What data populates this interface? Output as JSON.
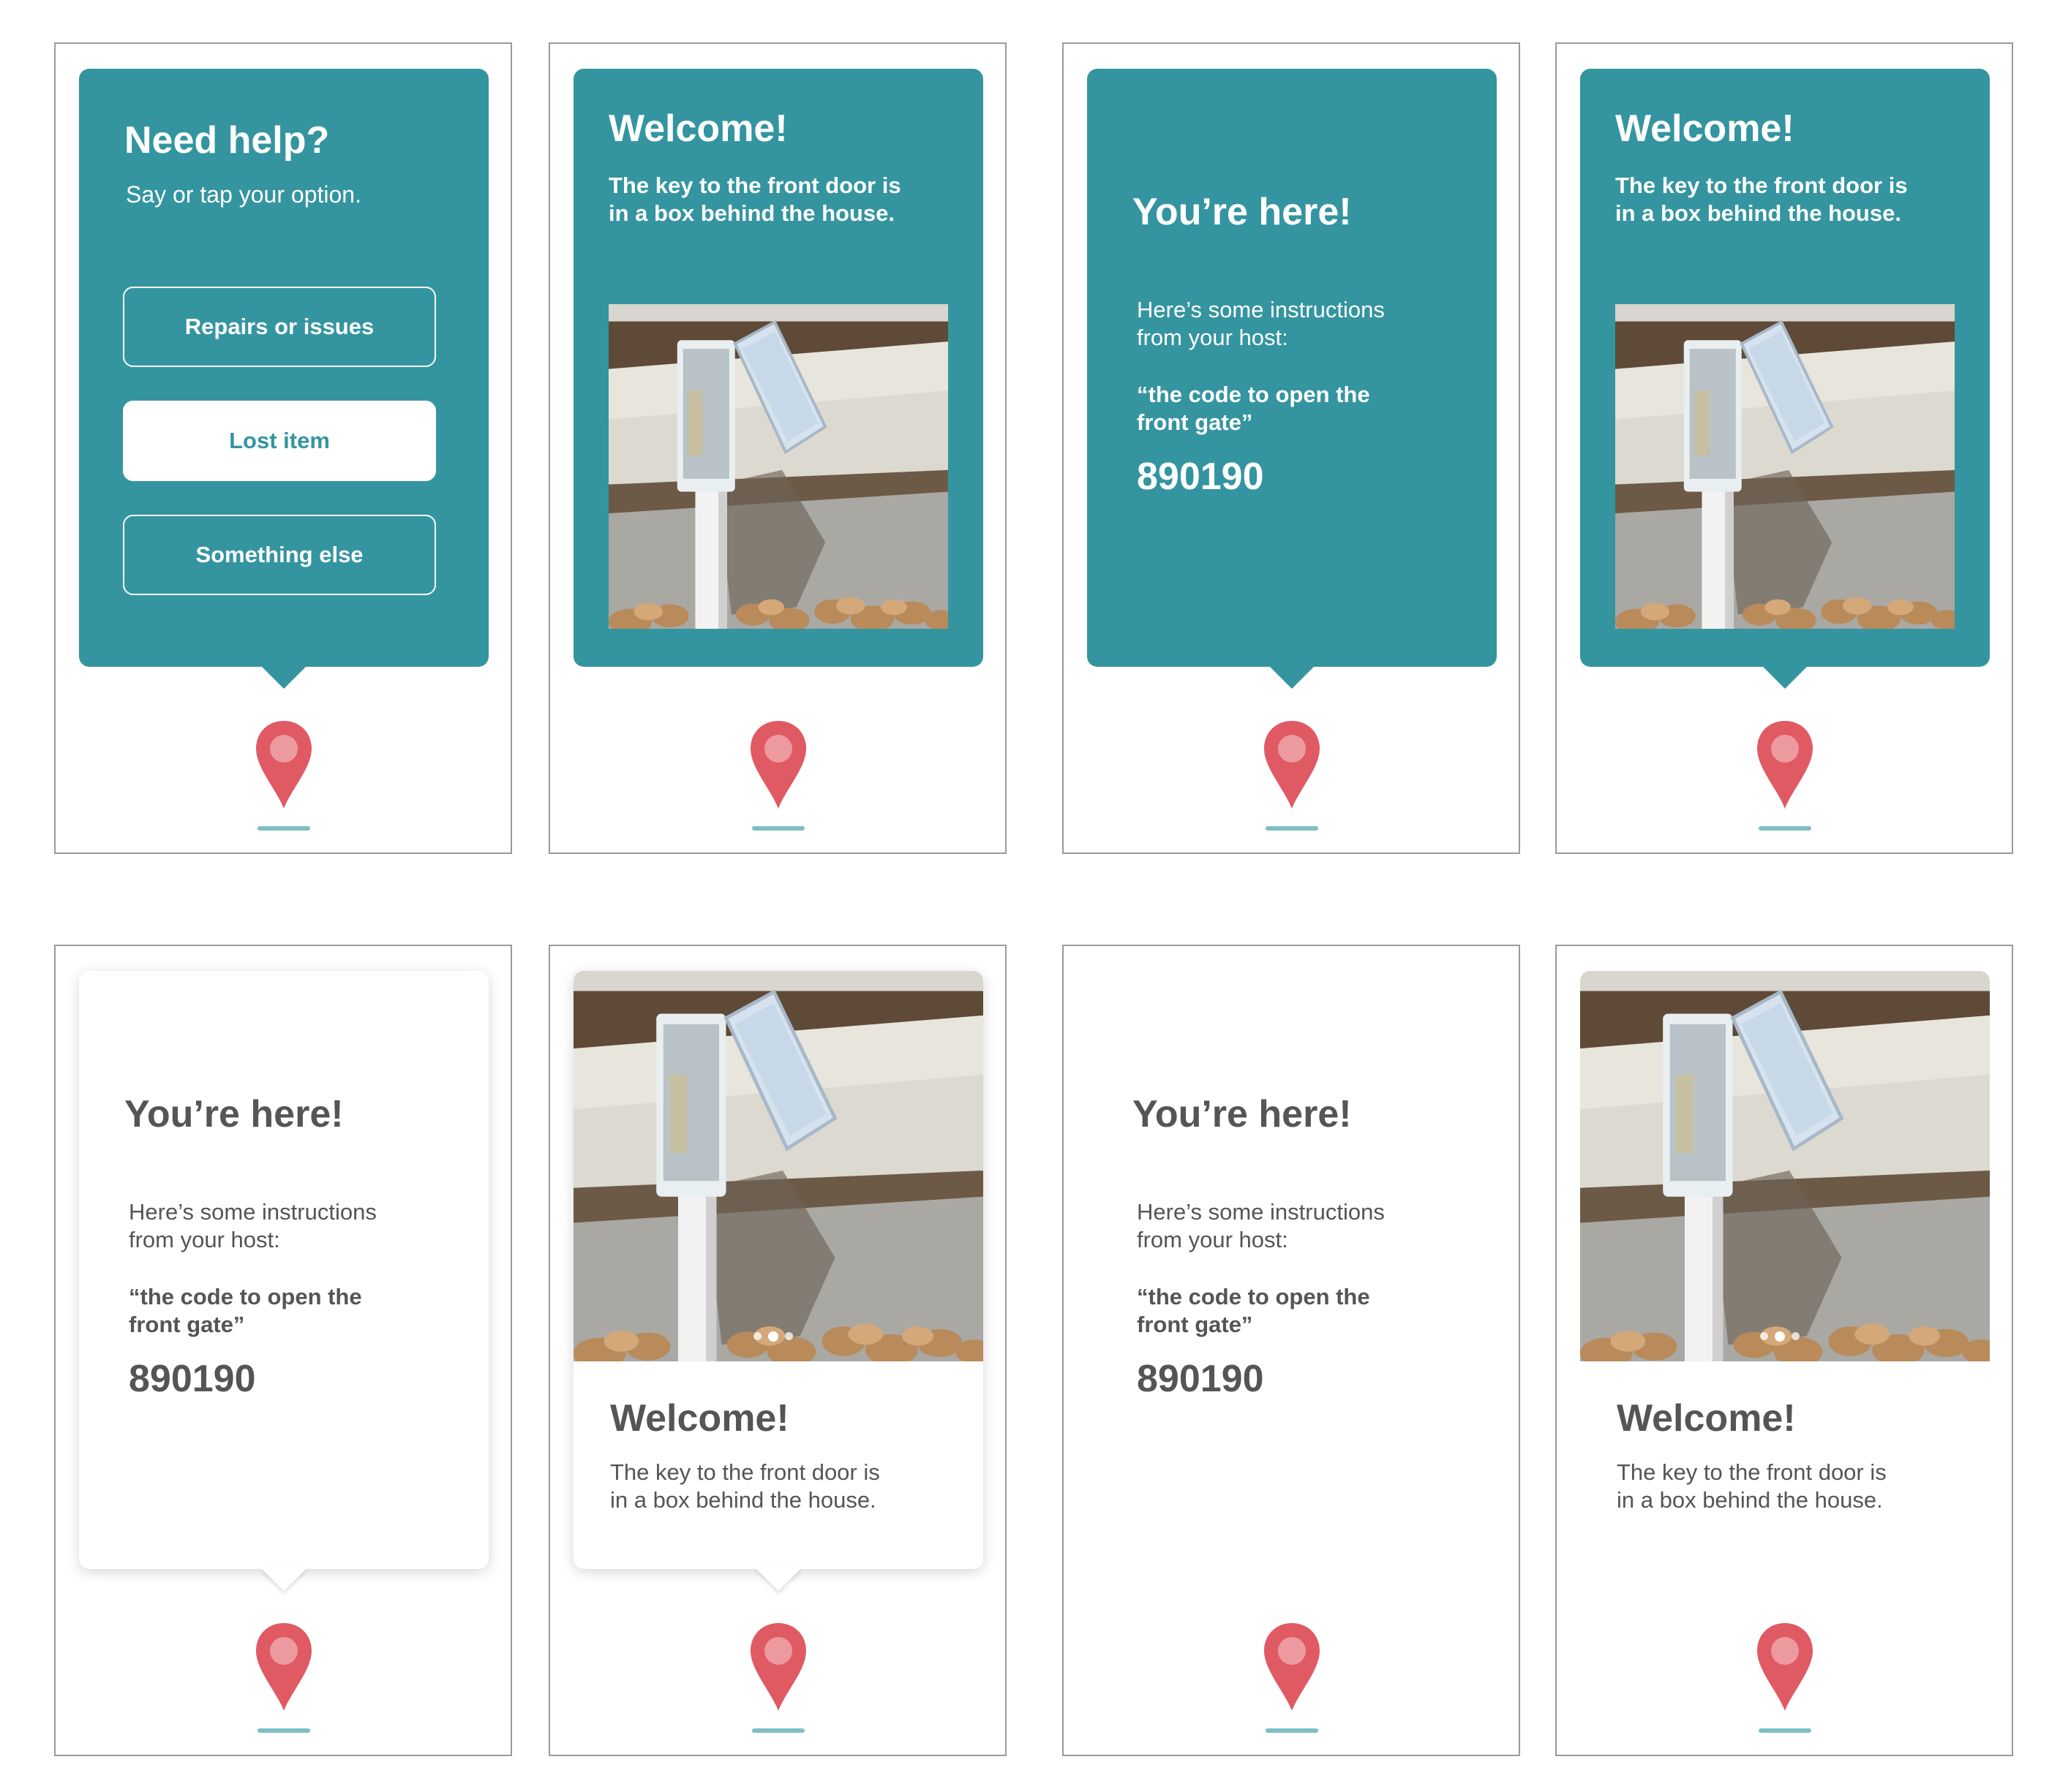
{
  "colors": {
    "teal": "#3495a0",
    "pin": "#e05a63",
    "pin_dot": "#ec9aa0",
    "underline": "#7fbfc3",
    "grey_text": "#555555"
  },
  "help": {
    "title": "Need help?",
    "subtitle": "Say or tap your option.",
    "options": [
      "Repairs or issues",
      "Lost item",
      "Something else"
    ],
    "selected": "Lost item"
  },
  "welcome": {
    "title": "Welcome!",
    "body_line1": "The key to the front door is",
    "body_line2": "in a box behind the house.",
    "photo": "lockbox-photo",
    "carousel_dots": 3,
    "carousel_active": 2
  },
  "here": {
    "title": "You’re here!",
    "intro_line1": "Here’s some instructions",
    "intro_line2": "from your host:",
    "quote_line1": "“the code to open the",
    "quote_line2": "front gate”",
    "code": "890190"
  },
  "icons": {
    "pin": "map-pin-icon"
  }
}
